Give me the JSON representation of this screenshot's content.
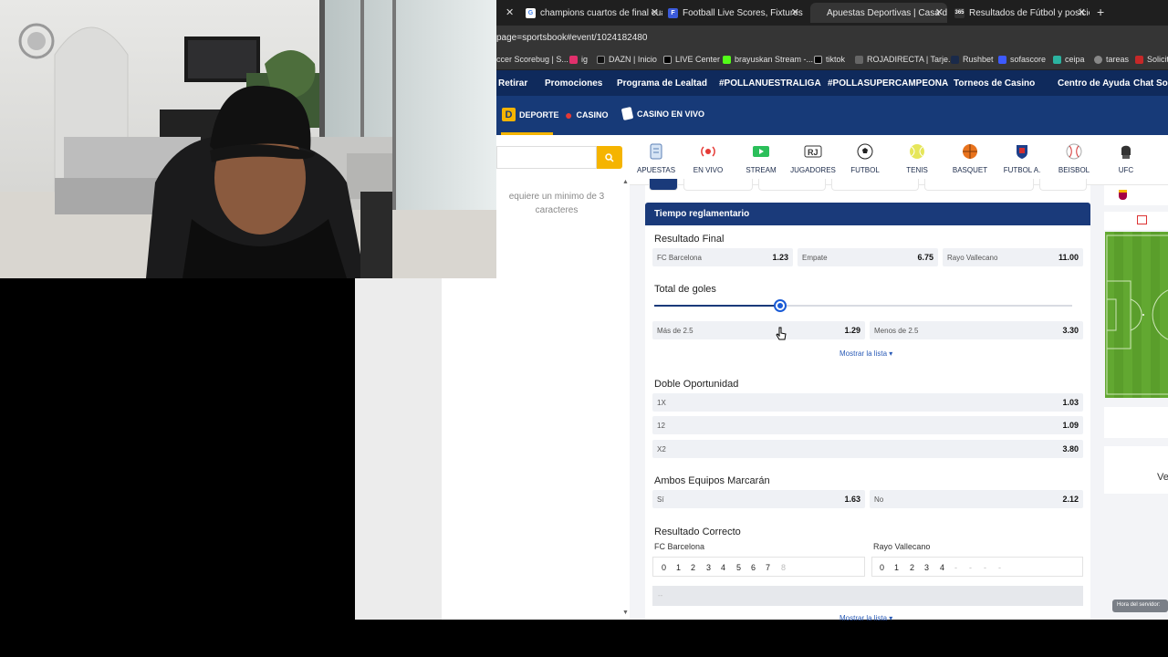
{
  "browser": {
    "tabs": [
      {
        "title": "champions cuartos de final cua",
        "active": false
      },
      {
        "title": "Football Live Scores, Fixtures &",
        "active": false
      },
      {
        "title": "Apuestas Deportivas | Casa de",
        "active": true
      },
      {
        "title": "Resultados de Fútbol y posicio",
        "active": false
      }
    ],
    "url": "page=sportsbook#event/1024182480",
    "bookmarks": [
      "ccer Scorebug | S...",
      "ig",
      "DAZN | Inicio",
      "LIVE Center",
      "brayuskan Stream -...",
      "tiktok",
      "ROJADIRECTA | Tarje...",
      "Rushbet",
      "sofascore",
      "ceipa",
      "tareas",
      "Solicit"
    ]
  },
  "site": {
    "nav": [
      "Retirar",
      "Promociones",
      "Programa de Lealtad",
      "#POLLANUESTRALIGA",
      "#POLLASUPERCAMPEONA",
      "Torneos de Casino",
      "Centro de Ayuda",
      "Chat Sop"
    ],
    "subnav": {
      "deporte": "DEPORTE",
      "casino": "CASINO",
      "casino_vivo": "CASINO EN VIVO",
      "logo_letter": "D"
    },
    "search_hint": "equiere un minimo de 3 caracteres",
    "sports": [
      "APUESTAS",
      "EN VIVO",
      "STREAM",
      "JUGADORES",
      "FUTBOL",
      "TENIS",
      "BASQUET",
      "FUTBOL A.",
      "BEISBOL",
      "UFC"
    ]
  },
  "market": {
    "header": "Tiempo reglamentario",
    "resultado_final": {
      "title": "Resultado Final",
      "odds": [
        {
          "name": "FC Barcelona",
          "price": "1.23"
        },
        {
          "name": "Empate",
          "price": "6.75"
        },
        {
          "name": "Rayo Vallecano",
          "price": "11.00"
        }
      ]
    },
    "total_goles": {
      "title": "Total de goles",
      "slider_value_fraction": 0.3,
      "odds": [
        {
          "name": "Más de  2.5",
          "price": "1.29"
        },
        {
          "name": "Menos de  2.5",
          "price": "3.30"
        }
      ],
      "show_list": "Mostrar la lista ▾"
    },
    "doble_oportunidad": {
      "title": "Doble Oportunidad",
      "odds": [
        {
          "name": "1X",
          "price": "1.03"
        },
        {
          "name": "12",
          "price": "1.09"
        },
        {
          "name": "X2",
          "price": "3.80"
        }
      ]
    },
    "ambos": {
      "title": "Ambos Equipos Marcarán",
      "odds": [
        {
          "name": "Sí",
          "price": "1.63"
        },
        {
          "name": "No",
          "price": "2.12"
        }
      ]
    },
    "correcto": {
      "title": "Resultado Correcto",
      "home": "FC Barcelona",
      "away": "Rayo Vallecano",
      "home_scores": [
        "0",
        "1",
        "2",
        "3",
        "4",
        "5",
        "6",
        "7",
        "8"
      ],
      "away_scores": [
        "0",
        "1",
        "2",
        "3",
        "4",
        "-",
        "-",
        "-",
        "-"
      ],
      "placeholder": "--",
      "show_list": "Mostrar la lista ▾"
    }
  },
  "right": {
    "ve": "Ve",
    "server_time": "Hora del servidor:"
  },
  "colors": {
    "navy": "#0f2a5c",
    "blue": "#173a78",
    "header": "#1a3a7a",
    "yellow": "#f5b400",
    "pitch": "#5a9e2b"
  }
}
